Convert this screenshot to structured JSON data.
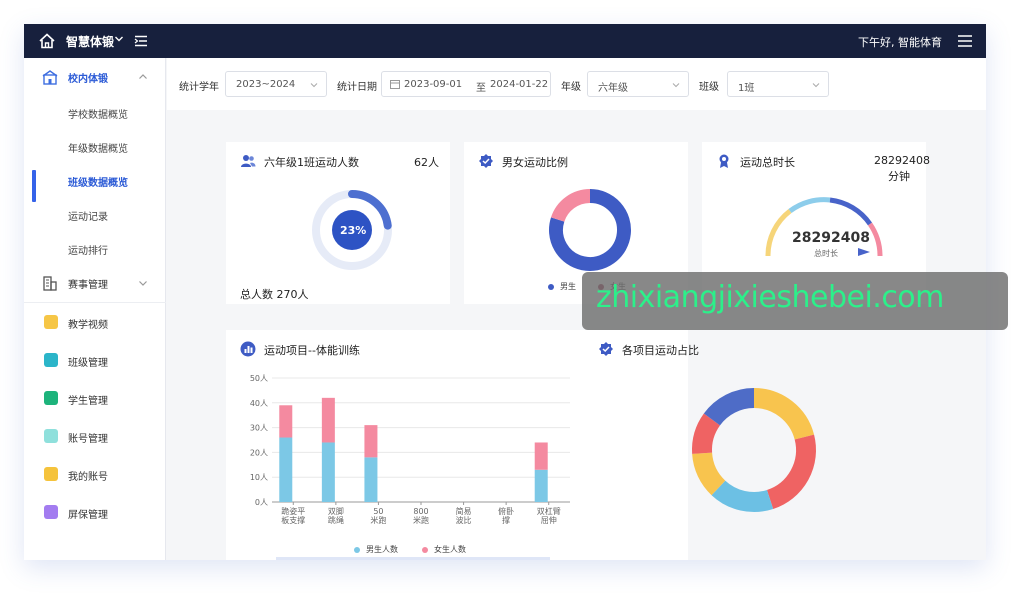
{
  "topbar": {
    "app_title": "智慧体锻",
    "greeting": "下午好, 智能体育"
  },
  "sidebar": {
    "group_school": "校内体锻",
    "sub_items": [
      "学校数据概览",
      "年级数据概览",
      "班级数据概览",
      "运动记录",
      "运动排行"
    ],
    "active_index": 2,
    "group_events": "赛事管理",
    "items": [
      {
        "label": "教学视频",
        "color": "#f6c646",
        "icon": "video-icon"
      },
      {
        "label": "班级管理",
        "color": "#2bb5c9",
        "icon": "class-icon"
      },
      {
        "label": "学生管理",
        "color": "#1db37b",
        "icon": "student-icon"
      },
      {
        "label": "账号管理",
        "color": "#37c6c0",
        "icon": "account-icon"
      },
      {
        "label": "我的账号",
        "color": "#f5b63c",
        "icon": "lock-icon"
      },
      {
        "label": "屏保管理",
        "color": "#8c62e6",
        "icon": "screensaver-icon"
      }
    ]
  },
  "filters": {
    "year_label": "统计学年",
    "year_value": "2023~2024",
    "date_label": "统计日期",
    "date_from": "2023-09-01",
    "date_sep": "至",
    "date_to": "2024-01-22",
    "grade_label": "年级",
    "grade_value": "六年级",
    "class_label": "班级",
    "class_value": "1班"
  },
  "card_participants": {
    "title": "六年级1班运动人数",
    "value": "62人",
    "percent_label": "23%",
    "percent": 23,
    "total_label": "总人数 270人"
  },
  "card_gender": {
    "title": "男女运动比例",
    "legend_male": "男生",
    "legend_female": "女生",
    "male_ratio": 0.8,
    "colors": {
      "male": "#3e5bc4",
      "female": "#f48aa0"
    }
  },
  "card_duration": {
    "title": "运动总时长",
    "value": "28292408",
    "unit": "分钟",
    "gauge_value": "28292408",
    "gauge_label": "总时长"
  },
  "card_items": {
    "title": "运动项目--体能训练",
    "legend_male": "男生人数",
    "legend_female": "女生人数"
  },
  "card_share": {
    "title": "各项目运动占比"
  },
  "chart_data": [
    {
      "type": "bar",
      "title": "运动项目--体能训练",
      "categories": [
        "跪姿平板支撑",
        "双脚跳绳",
        "50米跑",
        "800米跑",
        "简易波比",
        "俯卧撑",
        "双杠臂屈伸"
      ],
      "series": [
        {
          "name": "男生人数",
          "values": [
            26,
            24,
            18,
            0,
            0,
            0,
            13
          ],
          "color": "#7cc8e6"
        },
        {
          "name": "女生人数",
          "values": [
            13,
            18,
            13,
            0,
            0,
            0,
            11
          ],
          "color": "#f48aa0"
        }
      ],
      "yticks": [
        "0人",
        "10人",
        "20人",
        "30人",
        "40人",
        "50人"
      ],
      "ylim": [
        0,
        50
      ],
      "grid": true,
      "legend": "bottom"
    },
    {
      "type": "pie",
      "title": "各项目运动占比",
      "slices": [
        {
          "value": 21,
          "color": "#f8c44e"
        },
        {
          "value": 24,
          "color": "#ef6363"
        },
        {
          "value": 17,
          "color": "#6cc0e4"
        },
        {
          "value": 12,
          "color": "#f8c44e"
        },
        {
          "value": 11,
          "color": "#ef6363"
        },
        {
          "value": 15,
          "color": "#4e6cc7"
        }
      ]
    }
  ],
  "watermark": "zhixiangjixieshebei.com"
}
